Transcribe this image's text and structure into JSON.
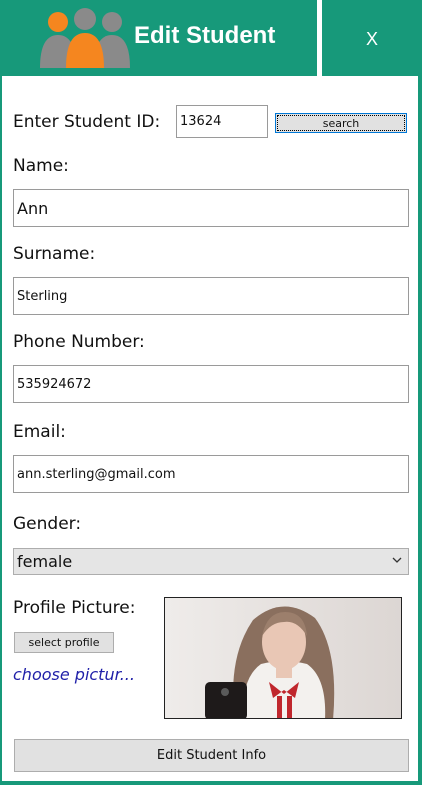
{
  "header": {
    "title": "Edit Student",
    "close_label": "X"
  },
  "form": {
    "student_id_label": "Enter Student ID:",
    "student_id_value": "13624",
    "search_label": "search",
    "name_label": "Name:",
    "name_value": "Ann",
    "surname_label": "Surname:",
    "surname_value": "Sterling",
    "phone_label": "Phone Number:",
    "phone_value": "535924672",
    "email_label": "Email:",
    "email_value": "ann.sterling@gmail.com",
    "gender_label": "Gender:",
    "gender_value": "female",
    "profile_label": "Profile Picture:",
    "select_profile_label": "select profile",
    "choose_picture_text": "choose pictur...",
    "submit_label": "Edit Student Info"
  },
  "icons": {
    "logo": "students-group-icon",
    "dropdown": "chevron-down-icon"
  },
  "colors": {
    "brand": "#17997a",
    "person_orange": "#f5861f",
    "person_gray": "#8a8a8a",
    "link": "#1f1fa8"
  }
}
